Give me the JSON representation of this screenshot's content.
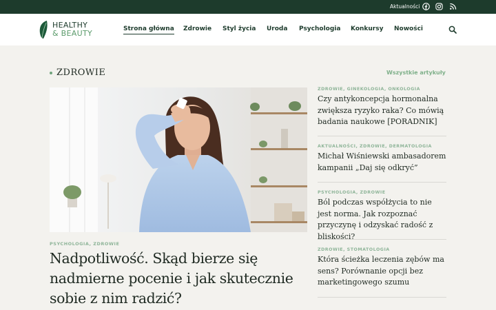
{
  "topbar": {
    "news_label": "Aktualności",
    "social": [
      "facebook-icon",
      "instagram-icon",
      "rss-icon"
    ]
  },
  "brand": {
    "line1": "HEALTHY",
    "line2": "& BEAUTY"
  },
  "nav": {
    "items": [
      {
        "label": "Strona główna",
        "active": true
      },
      {
        "label": "Zdrowie"
      },
      {
        "label": "Styl życia"
      },
      {
        "label": "Uroda"
      },
      {
        "label": "Psychologia"
      },
      {
        "label": "Konkursy"
      },
      {
        "label": "Nowości"
      }
    ]
  },
  "section": {
    "title": "ZDROWIE",
    "all_link": "Wszystkie artykuły"
  },
  "featured": {
    "tags": "PSYCHOLOGIA, ZDROWIE",
    "title": "Nadpotliwość. Skąd bierze się nadmierne pocenie i jak skutecznie sobie z nim radzić?"
  },
  "side_articles": [
    {
      "tags": "ZDROWIE, GINEKOLOGIA, ONKOLOGIA",
      "title": "Czy antykoncepcja hormonalna zwiększa ryzyko raka? Co mówią badania naukowe [PORADNIK]"
    },
    {
      "tags": "AKTUALNOŚCI, ZDROWIE, DERMATOLOGIA",
      "title": "Michał Wiśniewski ambasadorem kampanii „Daj się odkryć”"
    },
    {
      "tags": "PSYCHOLOGIA, ZDROWIE",
      "title": "Ból podczas współżycia to nie jest norma. Jak rozpoznać przyczynę i odzyskać radość z bliskości?"
    },
    {
      "tags": "ZDROWIE, STOMATOLOGIA",
      "title": "Która ścieżka leczenia zębów ma sens? Porównanie opcji bez marketingowego szumu"
    }
  ],
  "colors": {
    "topbar": "#1d3b2c",
    "accent": "#7fb08a",
    "page_bg": "#f3f2ee"
  }
}
